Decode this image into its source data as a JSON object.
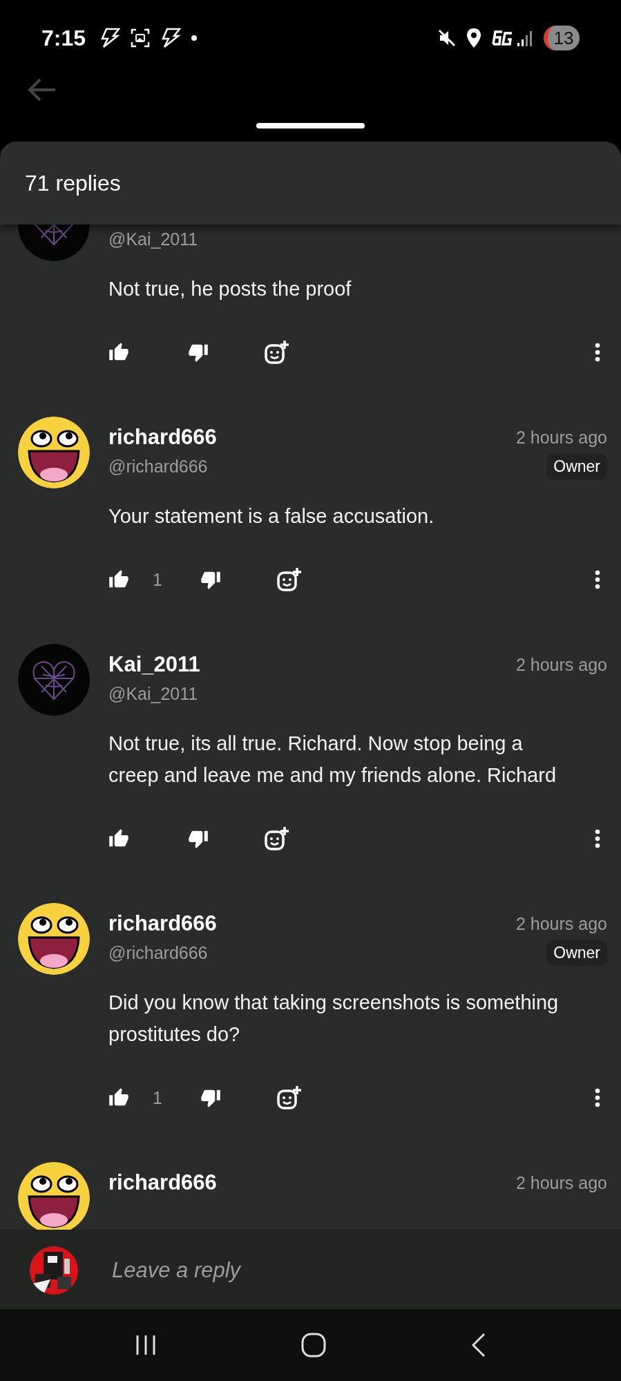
{
  "status_bar": {
    "time": "7:15",
    "battery": "13"
  },
  "sheet": {
    "title": "71 replies"
  },
  "comments": [
    {
      "avatar": {
        "kind": "web"
      },
      "handle": "@Kai_2011",
      "text": "Not true, he posts the proof"
    },
    {
      "avatar": {
        "kind": "smiley"
      },
      "name": "richard666",
      "time": "2 hours ago",
      "handle": "@richard666",
      "badge": "Owner",
      "text": "Your statement is a false accusation.",
      "likes": "1"
    },
    {
      "avatar": {
        "kind": "web"
      },
      "name": "Kai_2011",
      "time": "2 hours ago",
      "handle": "@Kai_2011",
      "text": "Not true, its all true. Richard. Now stop being a creep and leave me and my friends alone. Richard"
    },
    {
      "avatar": {
        "kind": "smiley"
      },
      "name": "richard666",
      "time": "2 hours ago",
      "handle": "@richard666",
      "badge": "Owner",
      "text": "Did you know that taking screenshots is something prostitutes do?",
      "likes": "1"
    },
    {
      "avatar": {
        "kind": "smiley"
      },
      "name": "richard666",
      "time": "2 hours ago"
    }
  ],
  "reply_bar": {
    "placeholder": "Leave a reply"
  }
}
